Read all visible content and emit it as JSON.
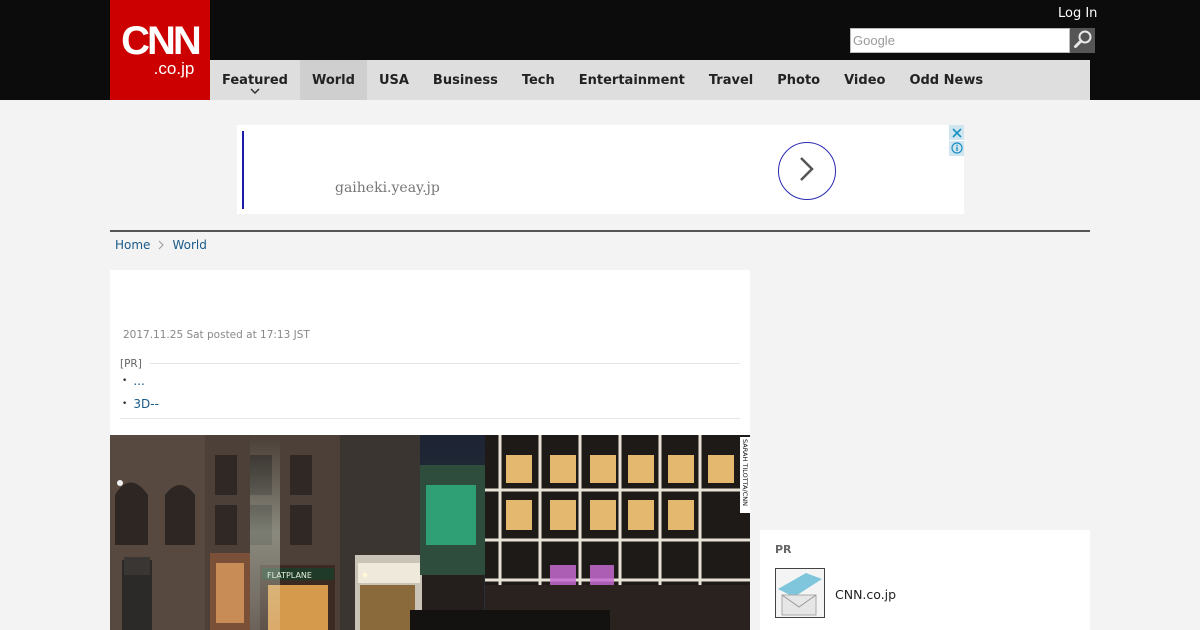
{
  "header": {
    "logo_top": "CNN",
    "logo_bottom": ".co.jp",
    "login_label": "Log In",
    "search_placeholder": "Google"
  },
  "nav": {
    "items": [
      {
        "label": "Featured"
      },
      {
        "label": "World"
      },
      {
        "label": "USA"
      },
      {
        "label": "Business"
      },
      {
        "label": "Tech"
      },
      {
        "label": "Entertainment"
      },
      {
        "label": "Travel"
      },
      {
        "label": "Photo"
      },
      {
        "label": "Video"
      },
      {
        "label": "Odd News"
      }
    ],
    "active": "World"
  },
  "ad": {
    "domain": "gaiheki.yeay.jp",
    "accent_color": "#1b1ba8"
  },
  "breadcrumb": {
    "home": "Home",
    "current": "World"
  },
  "article": {
    "posted": "2017.11.25 Sat posted at 17:13 JST",
    "pr_label": "[PR]",
    "pr_links": [
      "...",
      "3D--"
    ],
    "photo_credit": "SARAH TILOTTA/CNN"
  },
  "sidebar": {
    "pr_heading": "PR",
    "item_text": "CNN.co.jp"
  },
  "colors": {
    "brand": "#cc0000",
    "link": "#1a5a8a",
    "topbar": "#0c0c0c",
    "nav_bg": "#dedede"
  }
}
